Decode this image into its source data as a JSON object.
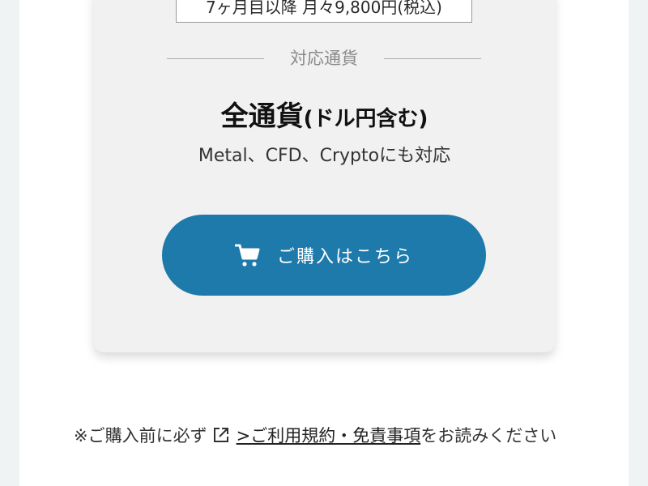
{
  "card": {
    "price_box_text": "7ヶ月目以降 月々9,800円(税込)",
    "section_label": "対応通貨",
    "currency_main": "全通貨",
    "currency_sub": "(ドル円含む)",
    "currency_note": "Metal、CFD、Cryptoにも対応",
    "buy_button_label": "ご購入はこちら",
    "buy_button_icon": "cart-icon"
  },
  "notice": {
    "prefix": "※ご購入前に必ず",
    "link_icon": "external-link-icon",
    "link_text": ">ご利用規約・免責事項",
    "suffix": "をお読みください"
  },
  "colors": {
    "page_background": "#f0f3f4",
    "card_background": "#f1f1f1",
    "button_background": "#1d7aaa",
    "button_text": "#ffffff"
  }
}
